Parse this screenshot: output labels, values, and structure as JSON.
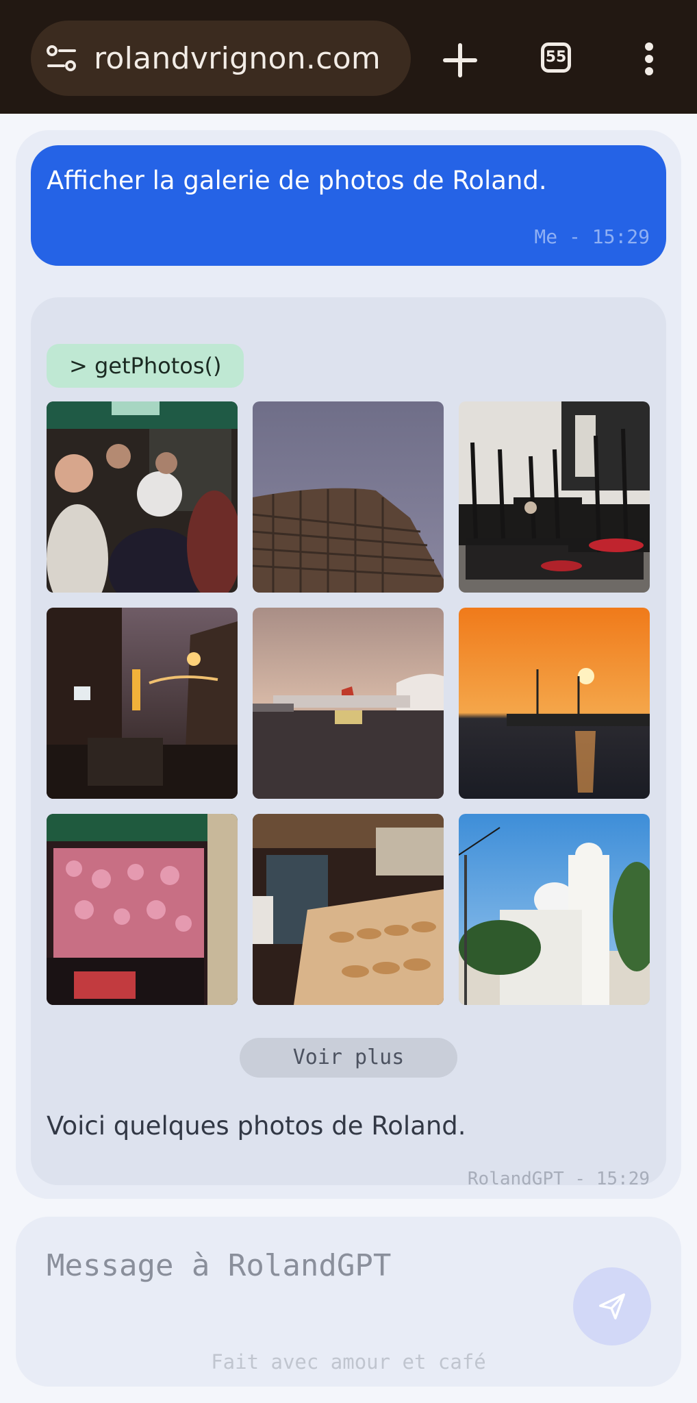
{
  "browser": {
    "url": "rolandvrignon.com",
    "tab_count": "55"
  },
  "chat": {
    "user_message": {
      "text": "Afficher la galerie de photos de Roland.",
      "meta": "Me - 15:29"
    },
    "bot_message": {
      "tool_call": "> getPhotos()",
      "photos": [
        {
          "subject": "party-crowd"
        },
        {
          "subject": "apartment-tower"
        },
        {
          "subject": "cafe-chairs"
        },
        {
          "subject": "night-street"
        },
        {
          "subject": "airport-tarmac"
        },
        {
          "subject": "sea-sunset"
        },
        {
          "subject": "fairground-stall"
        },
        {
          "subject": "bakery-counter"
        },
        {
          "subject": "white-church"
        }
      ],
      "more_label": "Voir plus",
      "text": "Voici quelques photos de Roland.",
      "meta": "RolandGPT - 15:29"
    }
  },
  "composer": {
    "placeholder": "Message à RolandGPT",
    "footer": "Fait avec amour et café"
  },
  "colors": {
    "topbar": "#221812",
    "user_bubble": "#2563e6",
    "bot_bubble": "#dde2ee",
    "tool_chip": "#bfe8d3",
    "send_button": "#d2d8f7"
  }
}
